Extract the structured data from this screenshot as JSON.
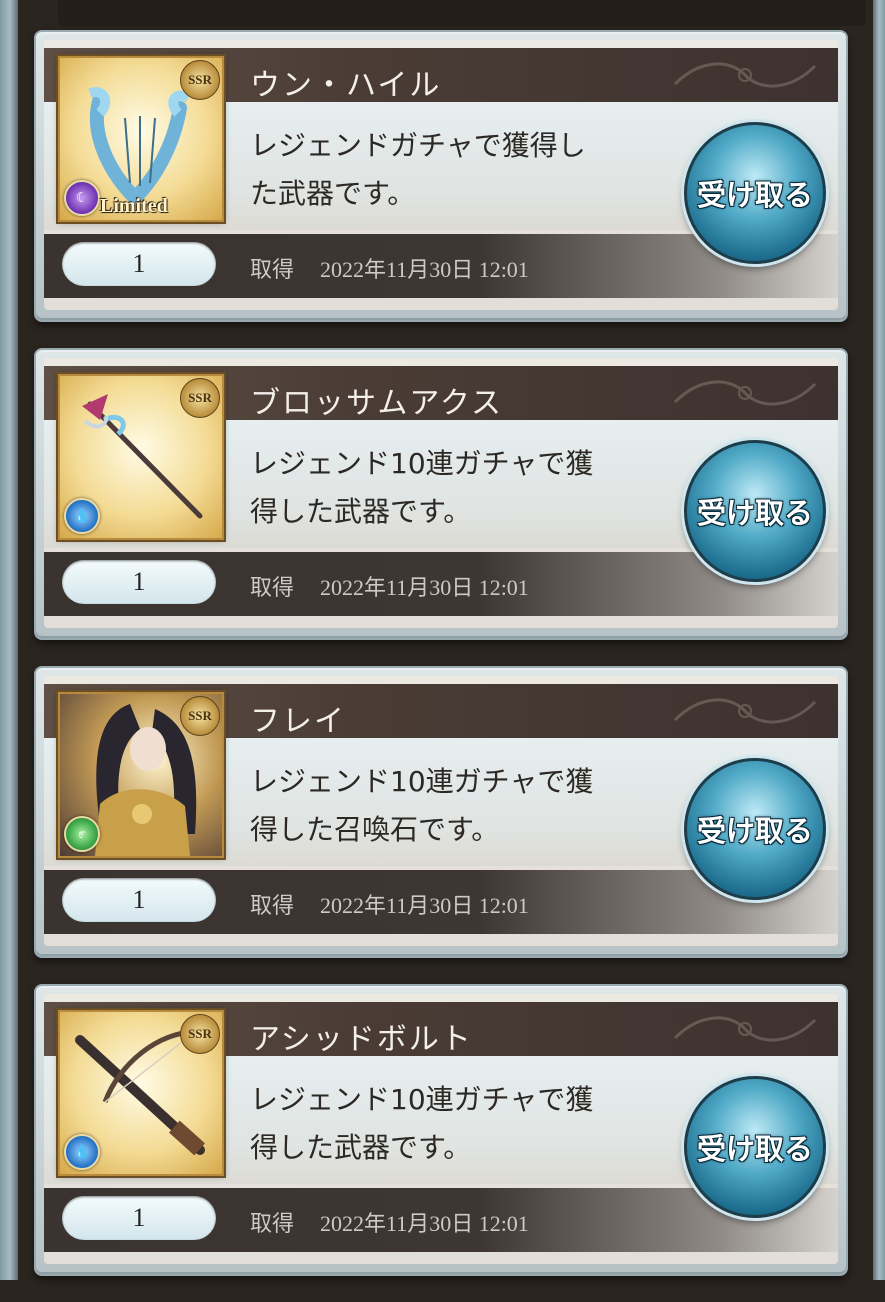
{
  "items": [
    {
      "name": "ウン・ハイル",
      "desc_line1": "レジェンドガチャで獲得し",
      "desc_line2": "た武器です。",
      "quantity": "1",
      "acquired_label": "取得",
      "acquired_date": "2022年11月30日 12:01",
      "rarity": "SSR",
      "element": "dark",
      "limited": "Limited",
      "button": "受け取る"
    },
    {
      "name": "ブロッサムアクス",
      "desc_line1": "レジェンド10連ガチャで獲",
      "desc_line2": "得した武器です。",
      "quantity": "1",
      "acquired_label": "取得",
      "acquired_date": "2022年11月30日 12:01",
      "rarity": "SSR",
      "element": "water",
      "button": "受け取る"
    },
    {
      "name": "フレイ",
      "desc_line1": "レジェンド10連ガチャで獲",
      "desc_line2": "得した召喚石です。",
      "quantity": "1",
      "acquired_label": "取得",
      "acquired_date": "2022年11月30日 12:01",
      "rarity": "SSR",
      "element": "wind",
      "button": "受け取る"
    },
    {
      "name": "アシッドボルト",
      "desc_line1": "レジェンド10連ガチャで獲",
      "desc_line2": "得した武器です。",
      "quantity": "1",
      "acquired_label": "取得",
      "acquired_date": "2022年11月30日 12:01",
      "rarity": "SSR",
      "element": "water",
      "button": "受け取る"
    }
  ]
}
